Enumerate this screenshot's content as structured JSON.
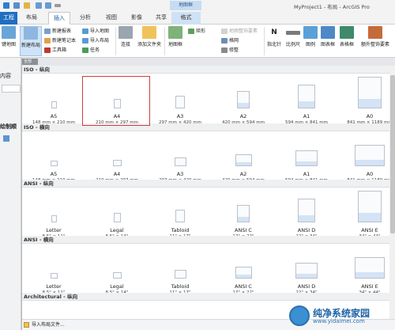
{
  "window": {
    "title": "MyProject1 - 布局 - ArcGIS Pro",
    "context_group_label": "地图框"
  },
  "tabs": [
    {
      "label": "工程"
    },
    {
      "label": "布局"
    },
    {
      "label": "插入"
    },
    {
      "label": "分析"
    },
    {
      "label": "视图"
    },
    {
      "label": "影像"
    },
    {
      "label": "共享"
    },
    {
      "label": "格式"
    }
  ],
  "ribbon": {
    "add_map": "键地图",
    "new_layout": "新建布局",
    "new_report": "新建报表",
    "new_notebook": "新建笔记本",
    "toolbox": "工具箱",
    "import_map": "导入地图",
    "import_layout": "导入布局",
    "task": "任务",
    "connect": "连接",
    "add_folder": "添加文件夹",
    "map_frame": "地图框",
    "rectangle": "矩形",
    "map_surrounds": "地图整饰要素",
    "grid": "格网",
    "trim": "修整",
    "north_arrow": "指北针",
    "scale_bar": "比例尺",
    "legend": "图例",
    "chart_frame": "图表框",
    "table_frame": "表格框",
    "extra_surrounds": "额外整饰要素"
  },
  "left_pane": {
    "label_content": "内容",
    "label_draw": "绘制顺"
  },
  "gallery": {
    "category_pill": "全部",
    "sections": [
      {
        "title": "ISO - 纵向",
        "orientation": "portrait",
        "tiles": [
          {
            "name": "A5",
            "size": "148 mm × 210 mm"
          },
          {
            "name": "A4",
            "size": "210 mm × 297 mm"
          },
          {
            "name": "A3",
            "size": "297 mm × 420 mm"
          },
          {
            "name": "A2",
            "size": "420 mm × 594 mm"
          },
          {
            "name": "A1",
            "size": "594 mm × 841 mm"
          },
          {
            "name": "A0",
            "size": "841 mm × 1189 mm"
          }
        ]
      },
      {
        "title": "ISO - 横向",
        "orientation": "landscape",
        "tiles": [
          {
            "name": "A5",
            "size": "148 mm × 210 mm"
          },
          {
            "name": "A4",
            "size": "210 mm × 297 mm"
          },
          {
            "name": "A3",
            "size": "297 mm × 420 mm"
          },
          {
            "name": "A2",
            "size": "420 mm × 594 mm"
          },
          {
            "name": "A1",
            "size": "594 mm × 841 mm"
          },
          {
            "name": "A0",
            "size": "841 mm × 1189 mm"
          }
        ]
      },
      {
        "title": "ANSI - 纵向",
        "orientation": "portrait",
        "tiles": [
          {
            "name": "Letter",
            "size": "8.5\" × 11\""
          },
          {
            "name": "Legal",
            "size": "8.5\" × 14\""
          },
          {
            "name": "Tabloid",
            "size": "11\" × 17\""
          },
          {
            "name": "ANSI C",
            "size": "17\" × 22\""
          },
          {
            "name": "ANSI D",
            "size": "22\" × 34\""
          },
          {
            "name": "ANSI E",
            "size": "34\" × 44\""
          }
        ]
      },
      {
        "title": "ANSI - 横向",
        "orientation": "landscape",
        "tiles": [
          {
            "name": "Letter",
            "size": "8.5\" × 11\""
          },
          {
            "name": "Legal",
            "size": "8.5\" × 14\""
          },
          {
            "name": "Tabloid",
            "size": "11\" × 17\""
          },
          {
            "name": "ANSI C",
            "size": "17\" × 22\""
          },
          {
            "name": "ANSI D",
            "size": "22\" × 34\""
          },
          {
            "name": "ANSI E",
            "size": "34\" × 44\""
          }
        ]
      },
      {
        "title": "Architectural - 纵向",
        "orientation": "portrait",
        "tiles": []
      }
    ],
    "selected": "A4",
    "import_label": "导入布局文件..."
  },
  "watermark": {
    "text": "纯净系统家园",
    "url": "www.yidaimei.com"
  },
  "colors": {
    "accent": "#1f6fc1",
    "selection_outline": "#d33c3c",
    "page_band": "#d4e3f5"
  }
}
